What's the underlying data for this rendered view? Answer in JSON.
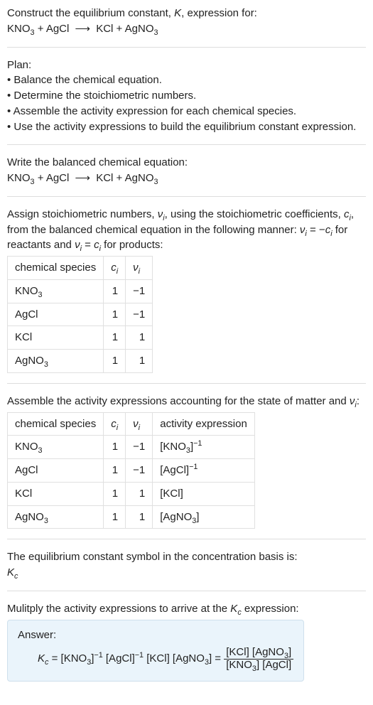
{
  "header": {
    "line1": "Construct the equilibrium constant, ",
    "K": "K",
    "line1b": ", expression for:"
  },
  "equation": {
    "r1": "KNO",
    "r1sub": "3",
    "plus": " + ",
    "r2": "AgCl",
    "arrow": "⟶",
    "p1": "KCl",
    "p2": "AgNO",
    "p2sub": "3"
  },
  "plan": {
    "title": "Plan:",
    "b1": "• Balance the chemical equation.",
    "b2": "• Determine the stoichiometric numbers.",
    "b3": "• Assemble the activity expression for each chemical species.",
    "b4": "• Use the activity expressions to build the equilibrium constant expression."
  },
  "balanced_intro": "Write the balanced chemical equation:",
  "assign": {
    "t1": "Assign stoichiometric numbers, ",
    "nu": "ν",
    "sub_i": "i",
    "t2": ", using the stoichiometric coefficients, ",
    "c": "c",
    "t3": ", from the balanced chemical equation in the following manner: ",
    "rule_lhs": "ν",
    "eq": " = −",
    "rule_rhs": "c",
    "t4": " for reactants and ",
    "eq2": " = ",
    "t5": " for products:"
  },
  "table1": {
    "h1": "chemical species",
    "h2_c": "c",
    "h3_nu": "ν",
    "rows": [
      {
        "name": "KNO",
        "sub": "3",
        "c": "1",
        "nu": "−1"
      },
      {
        "name": "AgCl",
        "sub": "",
        "c": "1",
        "nu": "−1"
      },
      {
        "name": "KCl",
        "sub": "",
        "c": "1",
        "nu": "1"
      },
      {
        "name": "AgNO",
        "sub": "3",
        "c": "1",
        "nu": "1"
      }
    ]
  },
  "assemble_intro_a": "Assemble the activity expressions accounting for the state of matter and ",
  "assemble_intro_b": ":",
  "table2": {
    "h1": "chemical species",
    "h2_c": "c",
    "h3_nu": "ν",
    "h4": "activity expression",
    "rows": [
      {
        "name": "KNO",
        "sub": "3",
        "c": "1",
        "nu": "−1",
        "a_base": "[KNO",
        "a_sub": "3",
        "a_close": "]",
        "a_exp": "−1"
      },
      {
        "name": "AgCl",
        "sub": "",
        "c": "1",
        "nu": "−1",
        "a_base": "[AgCl]",
        "a_sub": "",
        "a_close": "",
        "a_exp": "−1"
      },
      {
        "name": "KCl",
        "sub": "",
        "c": "1",
        "nu": "1",
        "a_base": "[KCl]",
        "a_sub": "",
        "a_close": "",
        "a_exp": ""
      },
      {
        "name": "AgNO",
        "sub": "3",
        "c": "1",
        "nu": "1",
        "a_base": "[AgNO",
        "a_sub": "3",
        "a_close": "]",
        "a_exp": ""
      }
    ]
  },
  "kc_basis": {
    "line": "The equilibrium constant symbol in the concentration basis is:",
    "K": "K",
    "sub": "c"
  },
  "multiply_a": "Mulitply the activity expressions to arrive at the ",
  "multiply_b": " expression:",
  "answer": {
    "label": "Answer:",
    "K": "K",
    "sub_c": "c",
    "eq": " = ",
    "t_kno3": "[KNO",
    "s_3": "3",
    "close": "]",
    "exp_neg1": "−1",
    "sp": " ",
    "t_agcl": "[AgCl]",
    "t_kcl": "[KCl]",
    "t_agno3": "[AgNO",
    "eq2": " = "
  }
}
